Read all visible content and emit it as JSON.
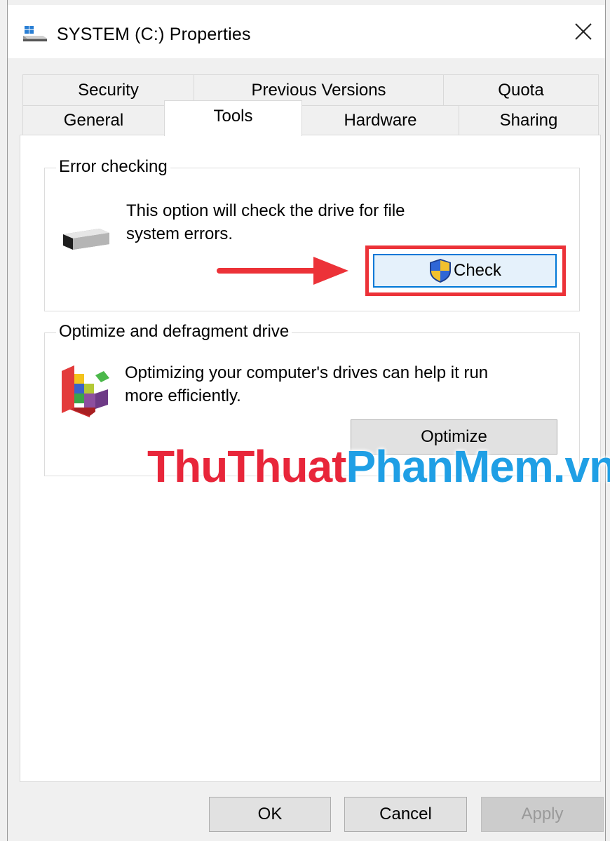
{
  "window": {
    "title": "SYSTEM (C:) Properties",
    "icon": "drive-icon",
    "close_symbol": "✕"
  },
  "tabs": {
    "row1": [
      {
        "label": "Security"
      },
      {
        "label": "Previous Versions"
      },
      {
        "label": "Quota"
      }
    ],
    "row2": [
      {
        "label": "General"
      },
      {
        "label": "Tools",
        "active": true
      },
      {
        "label": "Hardware"
      },
      {
        "label": "Sharing"
      }
    ]
  },
  "error_checking": {
    "legend": "Error checking",
    "line1": "This option will check the drive for file",
    "line2": "system errors.",
    "button_label": "Check",
    "button_icon": "uac-shield-icon"
  },
  "optimize": {
    "legend": "Optimize and defragment drive",
    "line1": "Optimizing your computer's drives can help it run",
    "line2": "more efficiently.",
    "button_label": "Optimize",
    "icon": "defrag-icon"
  },
  "watermark": {
    "part1": "ThuThuat",
    "part2": "PhanMem",
    "part3": ".vn"
  },
  "footer": {
    "ok_label": "OK",
    "cancel_label": "Cancel",
    "apply_label": "Apply"
  },
  "colors": {
    "annotation_red": "#ec3238",
    "focus_blue": "#0078d7",
    "watermark_red": "#e8263a",
    "watermark_blue": "#1f9fe5"
  }
}
